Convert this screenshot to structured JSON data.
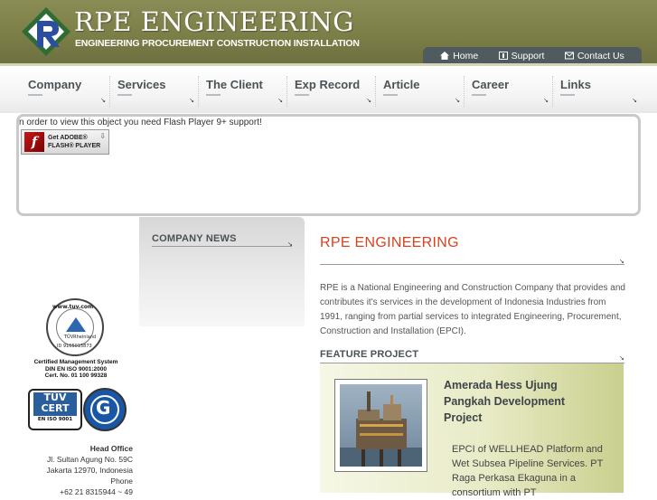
{
  "header": {
    "brand": "RPE ENGINEERING",
    "tagline": "ENGINEERING PROCUREMENT CONSTRUCTION INSTALLATION",
    "links": [
      {
        "label": "Home",
        "icon": "home-icon"
      },
      {
        "label": "Support",
        "icon": "support-icon"
      },
      {
        "label": "Contact Us",
        "icon": "mail-icon"
      }
    ]
  },
  "nav": {
    "items": [
      {
        "label": "Company"
      },
      {
        "label": "Services"
      },
      {
        "label": "The Client"
      },
      {
        "label": "Exp Record"
      },
      {
        "label": "Article"
      },
      {
        "label": "Career"
      },
      {
        "label": "Links"
      }
    ]
  },
  "flash": {
    "notice": "n order to view this object you need Flash Player 9+ support!",
    "badge_line1": "Get ADOBE®",
    "badge_line2": "FLASH® PLAYER"
  },
  "left": {
    "tuv_top": "www.tuv.com",
    "tuv_mid": "TÜVRheinland",
    "tuv_id": "ID 9105015873",
    "cert_lines": [
      "Certified Management System",
      "DIN EN ISO 9001:2000",
      "Cert. No. 01 100 99328"
    ],
    "cert_box_top": "TÜV CERT",
    "cert_box_mid": "EN ISO 9001",
    "address_heading": "Head Office",
    "address_lines": [
      "Jl. Sultan Agung No. 59C",
      "Jakarta 12970, Indonesia",
      "Phone",
      "+62 21 8315944 ~ 49"
    ]
  },
  "news": {
    "title": "COMPANY NEWS"
  },
  "main": {
    "title": "RPE ENGINEERING",
    "intro": "RPE is a National Engineering and Construction Company that provides and contributes it's services in the development of Indonesia Industries from 1991, ranging from partial services to integrated Engineering, Procurement, Construction and Installation (EPCI).",
    "feature_title": "FEATURE PROJECT",
    "feature_name": "Amerada Hess Ujung Pangkah Development Project",
    "feature_desc": "EPCI of WELLHEAD Platform and Wet Subsea Pipeline Services. PT Raga Perkasa Ekaguna in a consortium with PT"
  },
  "colors": {
    "header_olive": "#7b7e47",
    "accent_red": "#d8421f",
    "toplinks_bar": "#4f5b5f"
  }
}
